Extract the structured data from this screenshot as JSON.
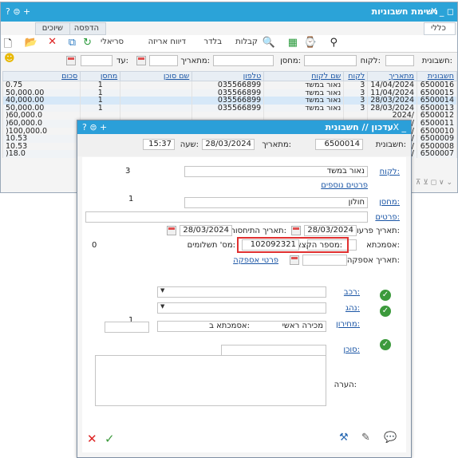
{
  "window": {
    "title": "רשימת חשבוניות",
    "controls": "X _ ◻",
    "left_controls": "? ⊜ +",
    "tabs": [
      "הדפסה",
      "שיוכים",
      "כללי"
    ],
    "toolbar": {
      "print_label": "קבלות",
      "filter_label": "בלדר",
      "delivery_label": "דיווח אריזה",
      "serial_label": "סריאלי"
    }
  },
  "filters": {
    "invoice_label": "חשבונית:",
    "customer_label": "לקוח:",
    "warehouse_label": "מחסן:",
    "from_date_label": "מתאריך:",
    "to_date_label": "עד:"
  },
  "grid": {
    "columns": [
      "חשבונית",
      "מתאריך",
      "לקוח",
      "שם לקוח",
      "טלפון",
      "שם סוכן",
      "מחסן",
      "סכום"
    ],
    "rows": [
      [
        "6500016",
        "14/04/2024",
        "3",
        "נאור במשד",
        "035566899",
        "",
        "1",
        "0.75"
      ],
      [
        "6500015",
        "11/04/2024",
        "3",
        "נאור במשד",
        "035566899",
        "",
        "1",
        "50,000.00"
      ],
      [
        "6500014",
        "28/03/2024",
        "3",
        "נאור במשד",
        "035566899",
        "",
        "1",
        "40,000.00"
      ],
      [
        "6500013",
        "28/03/2024",
        "3",
        "נאור במשד",
        "035566899",
        "",
        "1",
        "50,000.00"
      ],
      [
        "6500012",
        "/2024",
        "",
        "",
        "",
        "",
        "",
        "60,000.0("
      ],
      [
        "6500011",
        "/2024",
        "",
        "",
        "",
        "",
        "",
        "60,000.0("
      ],
      [
        "6500010",
        "/2024",
        "",
        "",
        "",
        "",
        "",
        "100,000.0("
      ],
      [
        "6500009",
        "/2024",
        "",
        "",
        "",
        "",
        "",
        "10.53"
      ],
      [
        "6500008",
        "/2024",
        "",
        "",
        "",
        "",
        "",
        "10.53"
      ],
      [
        "6500007",
        "/2024",
        "",
        "",
        "",
        "",
        "",
        "18.0("
      ]
    ]
  },
  "dialog": {
    "title": "עדכון // חשבונית",
    "left_controls": "? ⊜ +",
    "close": "X _",
    "invoice_label": "חשבונית:",
    "invoice_value": "6500014",
    "from_date_label": "מתאריך:",
    "from_date_value": "28/03/2024",
    "time_label": "שעה:",
    "time_value": "15:37",
    "customer_label": "לקוח:",
    "customer_name": "נאור במשד",
    "customer_code": "3",
    "more_details": "פרטים נוספים",
    "warehouse_label": "מחסן:",
    "warehouse_name": "חולון",
    "warehouse_code": "1",
    "details_label": "פרטים:",
    "due_date_label": "תאריך פרעון:",
    "due_date_value": "28/03/2024",
    "attribution_date_label": "תאריך התיחסות:",
    "attribution_date_value": "28/03/2024",
    "reference_label": "אסמכתא:",
    "allocation_label": "מספר הקצאה:",
    "allocation_value": "102092321",
    "payments_label": "מס' תשלומים:",
    "payments_value": "0",
    "supply_date_label": "תאריך אספקה:",
    "supply_details": "פרטי אספקה",
    "vehicle_label": "רכב:",
    "driver_label": "נהג:",
    "pricelist_label": "מחירון:",
    "pricelist_value": "מכירה ראשי",
    "pricelist_code": "1",
    "agent_label": "סוכן:",
    "agent_ref_label": "אסמכתא ב:",
    "note_label": "הערה:"
  }
}
